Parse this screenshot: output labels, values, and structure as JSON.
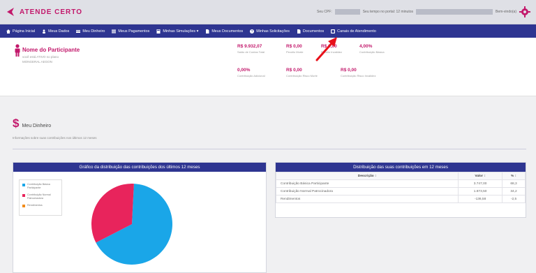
{
  "brand": {
    "name": "ATENDE CERTO"
  },
  "top": {
    "cpf_label": "Seu CPF:",
    "session_text": "Seu tempo no portal: 12 minutos",
    "user_text": "Bem-vindo(a)"
  },
  "nav": {
    "items": [
      {
        "label": "Página Inicial",
        "icon": "home-icon"
      },
      {
        "label": "Meus Dados",
        "icon": "user-icon"
      },
      {
        "label": "Meu Dinheiro",
        "icon": "card-icon"
      },
      {
        "label": "Meus Pagamentos",
        "icon": "list-icon"
      },
      {
        "label": "Minhas Simulações ▾",
        "icon": "calc-icon"
      },
      {
        "label": "Meus Documentos",
        "icon": "doc-icon"
      },
      {
        "label": "Minhas Solicitações",
        "icon": "help-icon"
      },
      {
        "label": "Documentos",
        "icon": "doc-icon"
      },
      {
        "label": "Canais de Atendimento",
        "icon": "phone-icon"
      }
    ]
  },
  "participant": {
    "name": "Nome do Participante",
    "sub1": "você está ATIVO no plano",
    "sub2": "MONGERAL AEGON",
    "stats_row1": [
      {
        "value": "R$ 9.932,07",
        "label": "Saldo de Contas Total"
      },
      {
        "value": "R$ 0,00",
        "label": "Pecúlio Morte"
      },
      {
        "value": "R$ 0,00",
        "label": "Pecúlio Invalidez"
      },
      {
        "value": "4,00%",
        "label": "Contribuição Básica"
      }
    ],
    "stats_row2": [
      {
        "value": "0,00%",
        "label": "Contribuição Adicional"
      },
      {
        "value": "R$ 0,00",
        "label": "Contribuição Risco Morte"
      },
      {
        "value": "R$ 0,00",
        "label": "Contribuição Risco Invalidez"
      }
    ]
  },
  "section": {
    "title": "Meu Dinheiro",
    "description": "Informações sobre suas contribuições nos últimos 12 meses"
  },
  "chart_panel": {
    "title": "Gráfico da distribuição das contribuições dos últimos 12 meses",
    "legend": [
      {
        "label": "Contribuição Básica Participante",
        "color": "#1aa6e8"
      },
      {
        "label": "Contribuição Normal Patrocinadora",
        "color": "#e8245c"
      },
      {
        "label": "Rendimentos",
        "color": "#f28c1b"
      }
    ]
  },
  "table_panel": {
    "title": "Distribuição das suas contribuições em 12 meses",
    "headers": [
      "Descrição ↕",
      "Valor ↕",
      "% ↕"
    ],
    "rows": [
      [
        "Contribuição Básica Participante",
        "3.747,00",
        "68,3"
      ],
      [
        "Contribuição Normal Patrocinadora",
        "1.873,50",
        "34,2"
      ],
      [
        "Rendimentos",
        "-136,58",
        "-2,5"
      ]
    ]
  },
  "chart_data": {
    "type": "pie",
    "categories": [
      "Contribuição Básica Participante",
      "Contribuição Normal Patrocinadora",
      "Rendimentos"
    ],
    "values": [
      68.3,
      34.2,
      -2.5
    ],
    "colors": [
      "#1aa6e8",
      "#e8245c",
      "#f28c1b"
    ],
    "title": "Gráfico da distribuição das contribuições dos últimos 12 meses",
    "legend": "top-left"
  }
}
